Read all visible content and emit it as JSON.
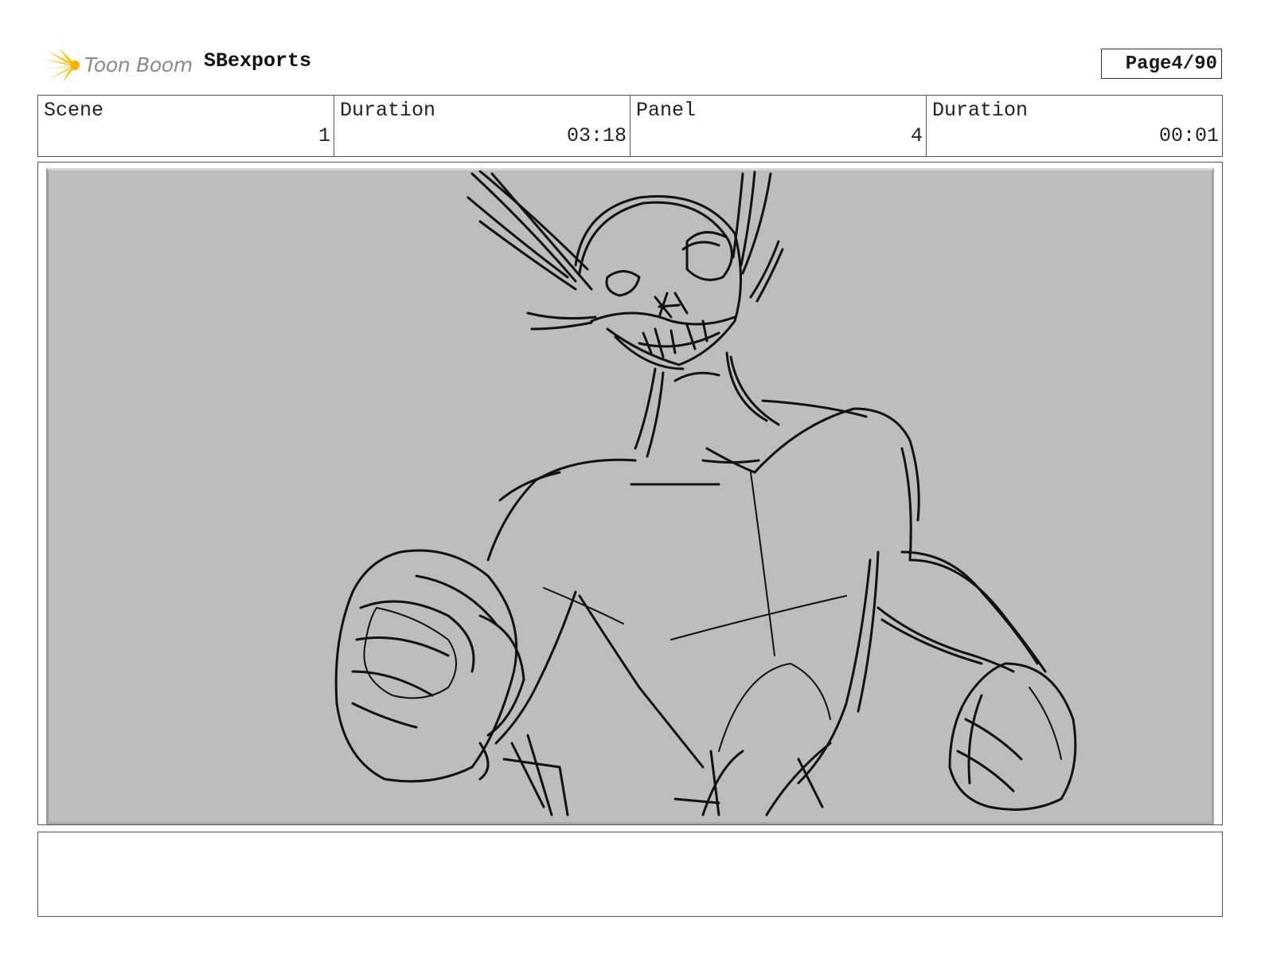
{
  "header": {
    "logo_text": "Toon Boom",
    "project_title": "SBexports",
    "page_label": "Page",
    "page_number": "4/90"
  },
  "info": {
    "scene_label": "Scene",
    "scene_value": "1",
    "scene_duration_label": "Duration",
    "scene_duration_value": "03:18",
    "panel_label": "Panel",
    "panel_value": "4",
    "panel_duration_label": "Duration",
    "panel_duration_value": "00:01"
  },
  "notes": {
    "text": ""
  },
  "colors": {
    "panel_background": "#bdbdbd",
    "sketch_stroke": "#111111",
    "logo_accent": "#f5c400"
  }
}
